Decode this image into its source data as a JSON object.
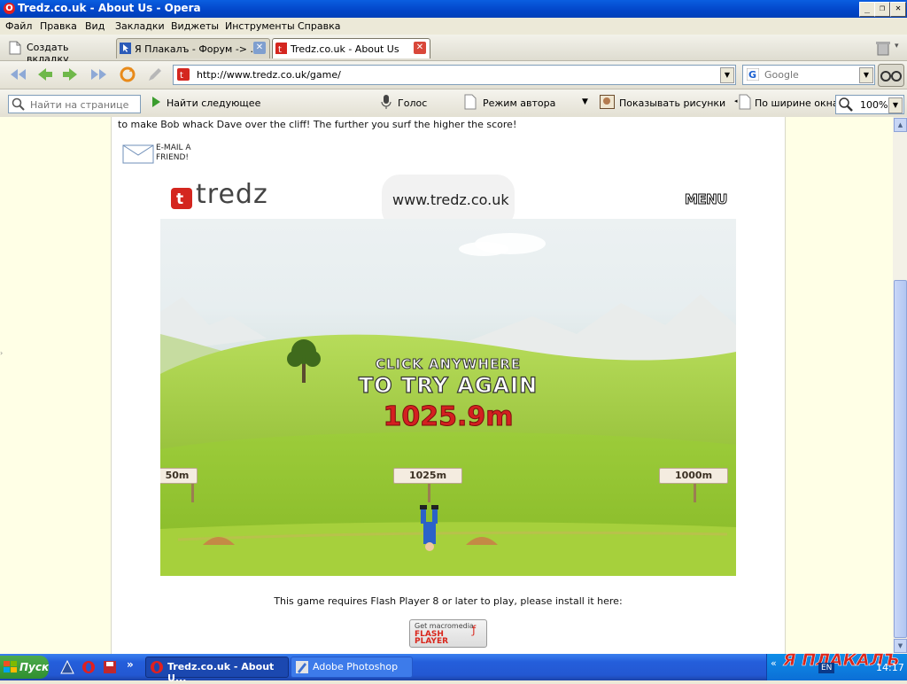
{
  "window": {
    "title": "Tredz.co.uk - About Us - Opera",
    "minimize": "_",
    "restore": "❐",
    "close": "✕"
  },
  "menu": [
    "Файл",
    "Правка",
    "Вид",
    "Закладки",
    "Виджеты",
    "Инструменты",
    "Справка"
  ],
  "tabs": {
    "new_tab_label": "Создать вкладку",
    "items": [
      {
        "label": "Я Плакалъ - Форум -> ...",
        "active": false
      },
      {
        "label": "Tredz.co.uk - About Us",
        "active": true
      }
    ]
  },
  "address": {
    "url": "http://www.tredz.co.uk/game/",
    "search_placeholder": "Google"
  },
  "toolbar2": {
    "find_placeholder": "Найти на странице",
    "find_next": "Найти следующее",
    "voice": "Голос",
    "author_mode": "Режим автора",
    "show_images": "Показывать рисунки",
    "fit_width": "По ширине окна",
    "zoom": "100%"
  },
  "page": {
    "intro_text": "to make Bob whack Dave over the cliff! The further you surf the higher the score!",
    "email_friend_line1": "E-MAIL A",
    "email_friend_line2": "FRIEND!",
    "flash_notice": "This game requires Flash Player 8 or later to play, please install it here:",
    "flash_badge_line1": "Get macromedia",
    "flash_badge_line2": "FLASH",
    "flash_badge_line3": "PLAYER"
  },
  "game": {
    "brand": "tredz",
    "site_url": "www.tredz.co.uk",
    "menu_label": "MENU",
    "prompt_line1": "CLICK ANYWHERE",
    "prompt_line2": "TO TRY AGAIN",
    "score": "1025.9m",
    "signs": [
      "50m",
      "1025m",
      "1000m"
    ],
    "colors": {
      "score": "#d42020",
      "grass": "#8fc62a",
      "brand": "#d4261f"
    }
  },
  "taskbar": {
    "start": "Пуск",
    "quick_more": "»",
    "items": [
      {
        "label": "Tredz.co.uk - About U...",
        "active": true
      },
      {
        "label": "Adobe Photoshop",
        "active": false
      }
    ],
    "tray_more": "«",
    "lang": "EN",
    "clock": "14:17",
    "watermark": "Я ПЛАКАЛЪ"
  }
}
